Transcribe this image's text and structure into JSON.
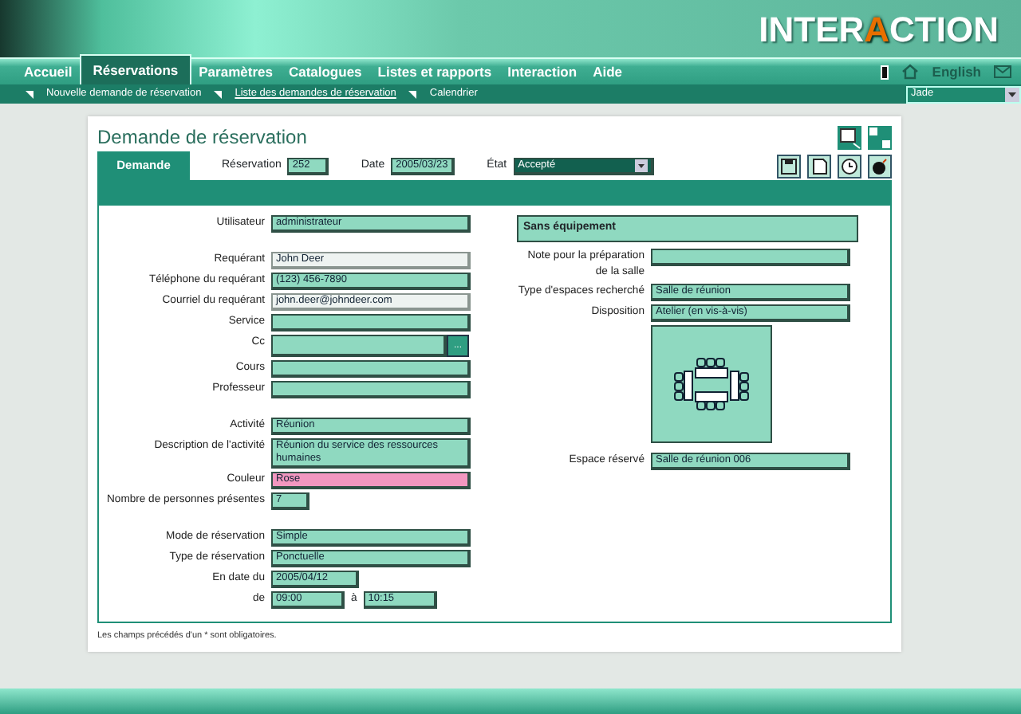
{
  "header": {
    "logo": {
      "parts": [
        {
          "text": "INTER",
          "accent": false
        },
        {
          "text": "A",
          "accent": true
        },
        {
          "text": "CTION",
          "accent": false
        }
      ]
    }
  },
  "nav": {
    "items": [
      {
        "label": "Accueil",
        "selected": false
      },
      {
        "label": "Réservations",
        "selected": true
      },
      {
        "label": "Paramètres",
        "selected": false
      },
      {
        "label": "Catalogues",
        "selected": false
      },
      {
        "label": "Listes et rapports",
        "selected": false
      },
      {
        "label": "Interaction",
        "selected": false
      },
      {
        "label": "Aide",
        "selected": false
      }
    ],
    "language": "English"
  },
  "subnav": {
    "items": [
      {
        "label": "Nouvelle demande de réservation",
        "selected": false
      },
      {
        "label": "Liste des demandes de réservation",
        "selected": true
      },
      {
        "label": "Calendrier",
        "selected": false
      }
    ],
    "theme": "Jade"
  },
  "form": {
    "title": "Demande de réservation",
    "tabs": [
      {
        "label": "Demande",
        "selected": true
      }
    ],
    "reservation": {
      "label": "Réservation",
      "value": "252"
    },
    "date": {
      "label": "Date",
      "value": "2005/03/23"
    },
    "state": {
      "label": "État",
      "value": "Accepté"
    },
    "left_groups": [
      [
        {
          "label": "Utilisateur",
          "value": "administrateur",
          "kind": "text",
          "editable": false
        }
      ],
      [
        {
          "label": "Requérant",
          "value": "John Deer",
          "kind": "text",
          "editable": true
        },
        {
          "label": "Téléphone du requérant",
          "value": "(123) 456-7890",
          "kind": "text",
          "editable": false
        },
        {
          "label": "Courriel du requérant",
          "value": "john.deer@johndeer.com",
          "kind": "text",
          "editable": true
        },
        {
          "label": "Service",
          "kind": "text",
          "editable": false
        },
        {
          "label": "Cc",
          "kind": "lookup",
          "button": "...",
          "editable": false
        },
        {
          "label": "Cours",
          "kind": "text",
          "editable": false
        },
        {
          "label": "Professeur",
          "kind": "text",
          "editable": false
        }
      ],
      [
        {
          "label": "Activité",
          "value": "Réunion",
          "kind": "text",
          "editable": false
        },
        {
          "label": "Description de l'activité",
          "value": "Réunion du service des ressources humaines",
          "kind": "text",
          "editable": false
        },
        {
          "label": "Couleur",
          "value": "Rose",
          "kind": "text",
          "editable": false,
          "color": "#f297c0"
        },
        {
          "label": "Nombre de personnes présentes",
          "value": "7",
          "kind": "tiny",
          "editable": false
        }
      ],
      [
        {
          "label": "Mode de réservation",
          "value": "Simple",
          "kind": "text",
          "editable": false
        },
        {
          "label": "Type de réservation",
          "value": "Ponctuelle",
          "kind": "text",
          "editable": false
        },
        {
          "label": "En date du",
          "value": "2005/04/12",
          "kind": "short",
          "editable": false
        },
        {
          "label": "de",
          "value": "09:00",
          "kind": "range",
          "separator": "à",
          "to": "10:15",
          "editable": false
        }
      ]
    ],
    "right": {
      "heading": "Sans équipement",
      "fields": [
        {
          "label": "Note pour la préparation de la salle",
          "kind": "text",
          "editable": false
        },
        {
          "label": "Type d'espaces recherché",
          "value": "Salle de réunion",
          "kind": "text",
          "editable": false
        },
        {
          "label": "Disposition",
          "value": "Atelier (en vis-à-vis)",
          "kind": "text",
          "editable": false
        },
        {
          "kind": "diagram"
        },
        {
          "label": "Espace réservé",
          "value": "Salle de réunion 006",
          "kind": "text",
          "editable": false
        }
      ]
    },
    "footnote": "Les champs précédés d'un * sont obligatoires."
  }
}
